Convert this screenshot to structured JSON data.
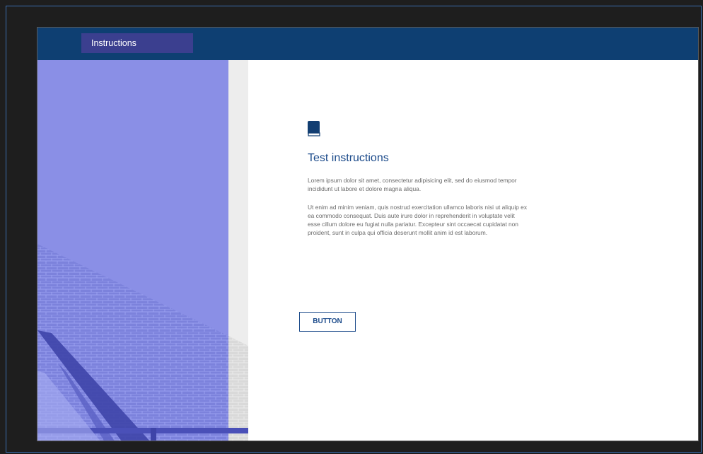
{
  "header": {
    "tab_label": "Instructions"
  },
  "hero": {
    "image_subject": "building-facade",
    "tint_color": "#8a8fe6"
  },
  "main": {
    "icon": "book-icon",
    "title": "Test instructions",
    "paragraph_1": "Lorem ipsum dolor sit amet, consectetur adipisicing elit, sed do eiusmod tempor incididunt ut labore et dolore magna aliqua.",
    "paragraph_2": "Ut enim ad minim veniam, quis nostrud exercitation ullamco laboris nisi ut aliquip ex ea commodo consequat. Duis aute irure dolor in reprehenderit in voluptate velit esse cillum dolore eu fugiat nulla pariatur. Excepteur sint occaecat cupidatat non proident, sunt in culpa qui officia deserunt mollit anim id est laborum.",
    "button_label": "BUTTON"
  },
  "colors": {
    "header_bg": "#0e3f72",
    "tab_bg": "#3b3f8f",
    "accent": "#1b4a8a"
  }
}
